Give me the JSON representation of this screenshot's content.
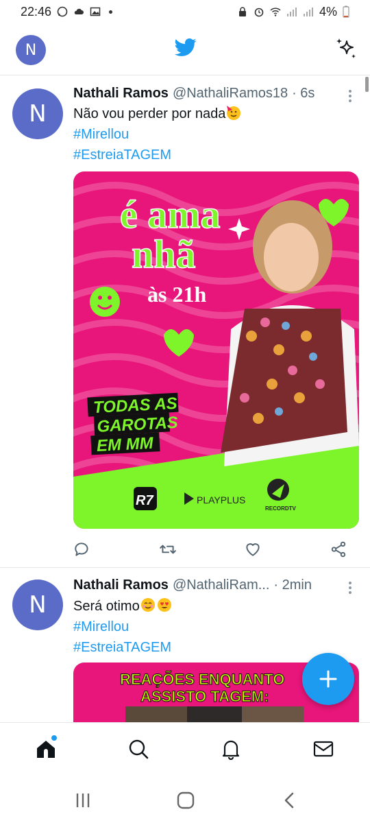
{
  "status": {
    "time": "22:46",
    "battery": "4%"
  },
  "header": {
    "avatar_letter": "N"
  },
  "tweets": [
    {
      "avatar_letter": "N",
      "name": "Nathali Ramos",
      "handle": "@NathaliRamos18",
      "time": "· 6s",
      "text": "Não vou perder por nada",
      "tags": [
        "#Mirellou",
        "#EstreiaTAGEM"
      ],
      "poster": {
        "line1": "é ama",
        "line2": "nhã",
        "line3": "às 21h",
        "todas": "TODAS AS",
        "garotas": "GAROTAS",
        "emmm": "EM MM",
        "brand1": "R7",
        "brand2": "PLAYPLUS",
        "brand3": "RECORDTV"
      }
    },
    {
      "avatar_letter": "N",
      "name": "Nathali Ramos",
      "handle": "@NathaliRam...",
      "time": "· 2min",
      "text": "Será otimo",
      "tags": [
        "#Mirellou",
        "#EstreiaTAGEM"
      ],
      "poster": {
        "line1": "REAÇÕES ENQUANTO",
        "line2": "ASSISTO TAGEM:"
      }
    }
  ],
  "colors": {
    "accent": "#1d9bf0",
    "avatar": "#5b6bc8",
    "poster_pink": "#e8167a",
    "poster_green": "#7ef52a"
  }
}
